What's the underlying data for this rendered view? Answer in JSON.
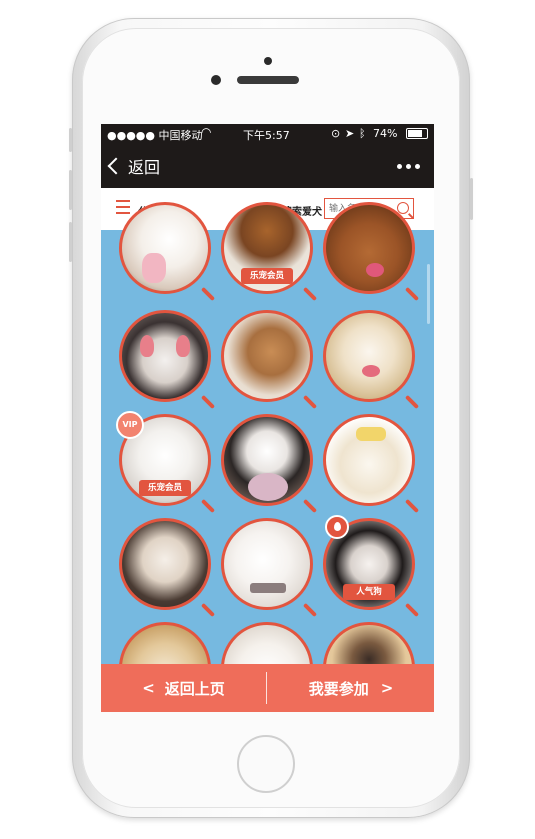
{
  "status_bar": {
    "carrier": "●●●●● 中国移动",
    "time": "下午5:57",
    "battery": "74%"
  },
  "nav": {
    "back_label": "返回"
  },
  "toolbar": {
    "category_label": "分类索引",
    "search_label": "搜索爱犬",
    "search_placeholder": "输入名字"
  },
  "badges": {
    "member": "乐宠会员",
    "popular": "人气狗",
    "vip": "VIP"
  },
  "bottom": {
    "prev_label": "返回上页",
    "join_label": "我要参加"
  },
  "colors": {
    "accent": "#e2553f",
    "background": "#76b9e0",
    "header": "#1e1a19",
    "bottom_bar": "#ef6d5a"
  }
}
